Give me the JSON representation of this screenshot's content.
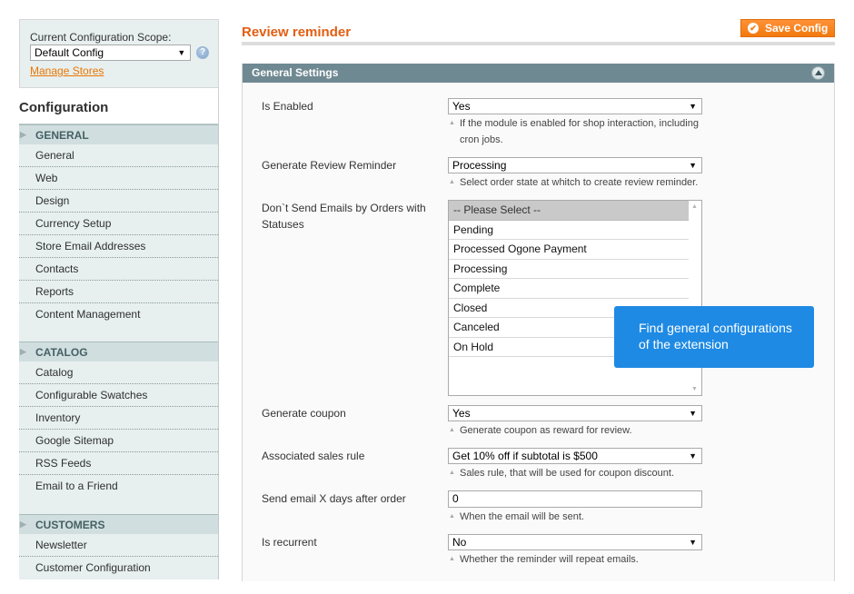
{
  "scope": {
    "label": "Current Configuration Scope:",
    "value": "Default Config",
    "help_icon": "?",
    "manage_stores": "Manage Stores"
  },
  "sidebar": {
    "title": "Configuration",
    "sections": [
      {
        "header": "GENERAL",
        "items": [
          "General",
          "Web",
          "Design",
          "Currency Setup",
          "Store Email Addresses",
          "Contacts",
          "Reports",
          "Content Management"
        ]
      },
      {
        "header": "CATALOG",
        "items": [
          "Catalog",
          "Configurable Swatches",
          "Inventory",
          "Google Sitemap",
          "RSS Feeds",
          "Email to a Friend"
        ]
      },
      {
        "header": "CUSTOMERS",
        "items": [
          "Newsletter",
          "Customer Configuration"
        ]
      }
    ]
  },
  "header": {
    "title": "Review reminder",
    "save_label": "Save Config"
  },
  "fieldset": {
    "title": "General Settings",
    "fields": {
      "is_enabled": {
        "label": "Is Enabled",
        "value": "Yes",
        "note": "If the module is enabled for shop interaction, including cron jobs."
      },
      "generate_reminder": {
        "label": "Generate Review Reminder",
        "value": "Processing",
        "note": "Select order state at whitch to create review reminder."
      },
      "dont_send": {
        "label": "Don`t Send Emails by Orders with Statuses",
        "options": [
          "-- Please Select --",
          "Pending",
          "Processed Ogone Payment",
          "Processing",
          "Complete",
          "Closed",
          "Canceled",
          "On Hold"
        ],
        "selected": "-- Please Select --"
      },
      "generate_coupon": {
        "label": "Generate coupon",
        "value": "Yes",
        "note": "Generate coupon as reward for review."
      },
      "sales_rule": {
        "label": "Associated sales rule",
        "value": "Get 10% off if subtotal is $500",
        "note": "Sales rule, that will be used for coupon discount."
      },
      "days_after": {
        "label": "Send email X days after order",
        "value": "0",
        "note": "When the email will be sent."
      },
      "is_recurrent": {
        "label": "Is recurrent",
        "value": "No",
        "note": "Whether the reminder will repeat emails."
      }
    }
  },
  "tooltip": {
    "text": "Find general configurations of the extension",
    "color": "#1e8ae4"
  },
  "colors": {
    "accent": "#e25e12",
    "save_button": "#f27a0e",
    "fieldset_header": "#6f8992",
    "nav_header_text": "#446164"
  }
}
